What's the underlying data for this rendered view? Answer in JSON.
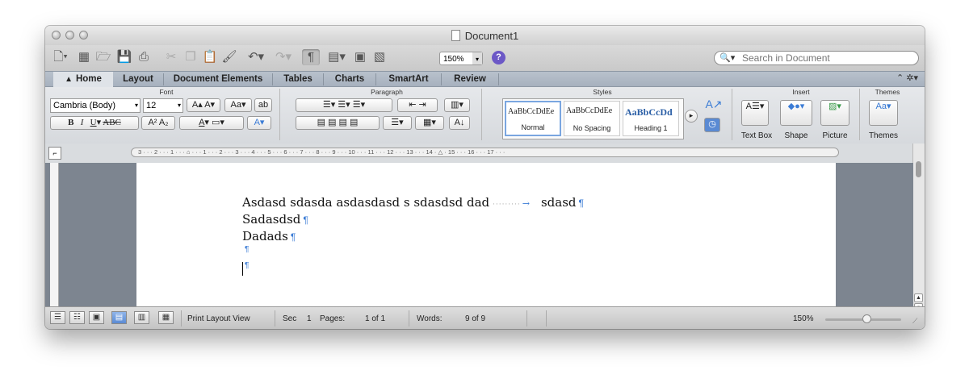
{
  "window": {
    "title": "Document1"
  },
  "toolbar": {
    "zoom": "150%",
    "search_placeholder": "Search in Document"
  },
  "tabs": [
    "Home",
    "Layout",
    "Document Elements",
    "Tables",
    "Charts",
    "SmartArt",
    "Review"
  ],
  "ribbon": {
    "groups": {
      "font": "Font",
      "paragraph": "Paragraph",
      "styles": "Styles",
      "insert": "Insert",
      "themes": "Themes"
    },
    "font_name": "Cambria (Body)",
    "font_size": "12",
    "styles": [
      {
        "preview": "AaBbCcDdEe",
        "name": "Normal"
      },
      {
        "preview": "AaBbCcDdEe",
        "name": "No Spacing"
      },
      {
        "preview": "AaBbCcDd",
        "name": "Heading 1"
      }
    ],
    "insert": {
      "textbox": "Text Box",
      "shape": "Shape",
      "picture": "Picture"
    },
    "themes_label": "Themes"
  },
  "ruler": {
    "text": "3 · · · 2 · · · 1 · · · ⌂ · · · 1 · · · 2 · · · 3 · · · 4 · · · 5 · · · 6 · · · 7 · · · 8 · · · 9 · · · 10 · · · 11 · · · 12 · · · 13 · · · 14 · △ · 15 · · · 16 · · · 17 · · ·"
  },
  "document": {
    "line1_a": "Asdasd sdasda asdasdasd s sdasdsd dad",
    "line1_b": "sdasd",
    "line2": "Sadasdsd",
    "line3": "Dadads",
    "pilcrow": "¶"
  },
  "status": {
    "view": "Print Layout View",
    "sec_label": "Sec",
    "sec": "1",
    "pages_label": "Pages:",
    "pages": "1 of 1",
    "words_label": "Words:",
    "words": "9 of 9",
    "zoom": "150%"
  }
}
